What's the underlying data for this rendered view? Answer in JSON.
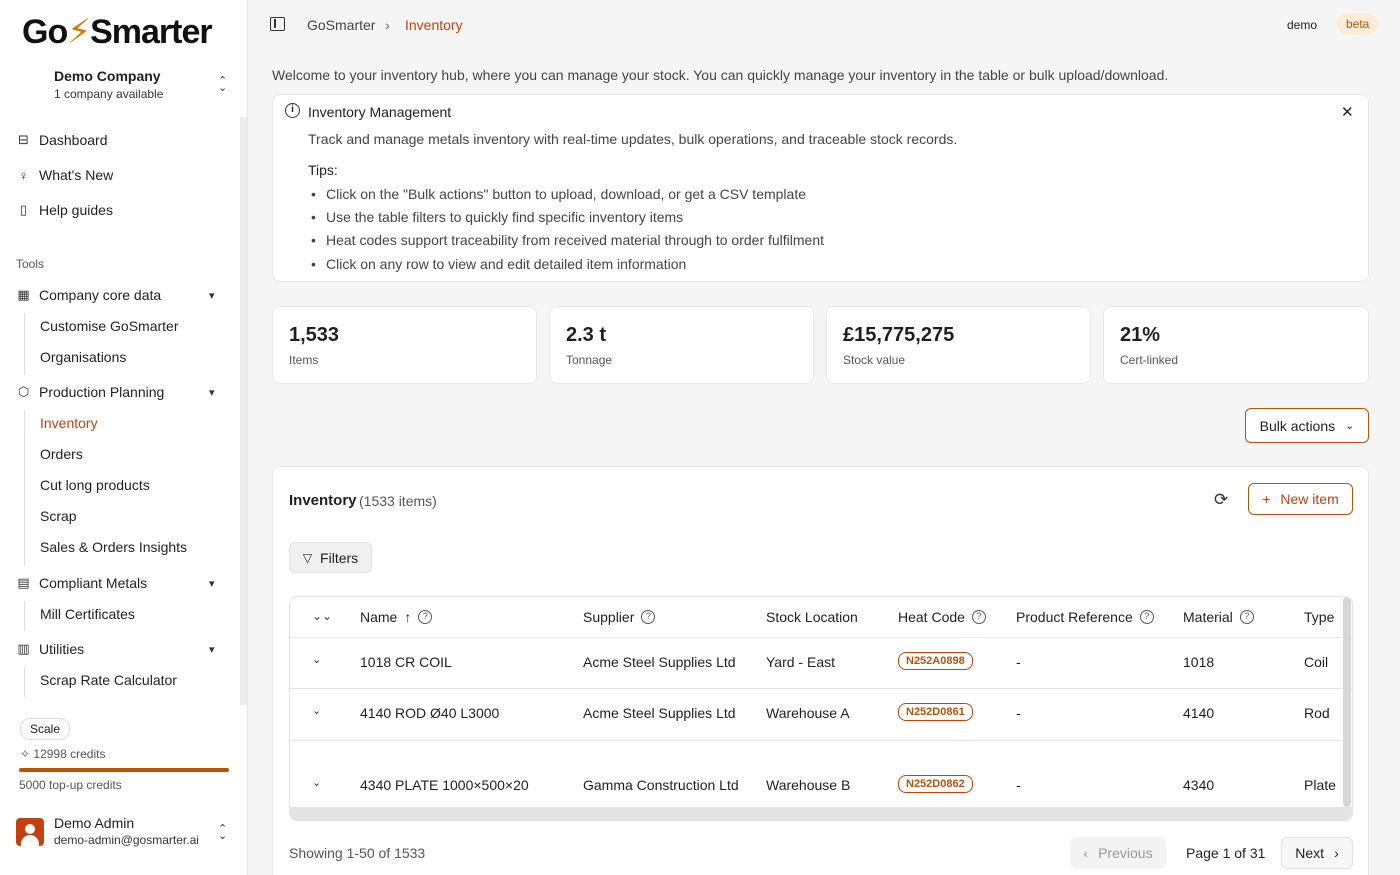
{
  "app": {
    "logo": "GoSmarter"
  },
  "company": {
    "name": "Demo Company",
    "sub": "1 company available"
  },
  "nav": {
    "dashboard": "Dashboard",
    "whats_new": "What's New",
    "help": "Help guides"
  },
  "tools_label": "Tools",
  "groups": {
    "core": {
      "label": "Company core data",
      "items": [
        "Customise GoSmarter",
        "Organisations"
      ]
    },
    "planning": {
      "label": "Production Planning",
      "items": [
        "Inventory",
        "Orders",
        "Cut long products",
        "Scrap",
        "Sales & Orders Insights"
      ]
    },
    "compliant": {
      "label": "Compliant Metals",
      "items": [
        "Mill Certificates"
      ]
    },
    "utilities": {
      "label": "Utilities",
      "items": [
        "Scrap Rate Calculator"
      ]
    }
  },
  "plan": {
    "name": "Scale",
    "credits": "12998 credits",
    "topup": "5000 top-up credits"
  },
  "user": {
    "name": "Demo Admin",
    "email": "demo-admin@gosmarter.ai"
  },
  "breadcrumb": {
    "home": "GoSmarter",
    "sep": "›",
    "current": "Inventory"
  },
  "header": {
    "user": "demo",
    "badge": "beta"
  },
  "welcome": "Welcome to your inventory hub, where you can manage your stock. You can quickly manage your inventory in the table or bulk upload/download.",
  "info": {
    "title": "Inventory Management",
    "desc": "Track and manage metals inventory with real-time updates, bulk operations, and traceable stock records.",
    "tips_title": "Tips:",
    "tips": [
      "Click on the \"Bulk actions\" button to upload, download, or get a CSV template",
      "Use the table filters to quickly find specific inventory items",
      "Heat codes support traceability from received material through to order fulfilment",
      "Click on any row to view and edit detailed item information"
    ]
  },
  "stats": [
    {
      "value": "1,533",
      "label": "Items"
    },
    {
      "value": "2.3 t",
      "label": "Tonnage"
    },
    {
      "value": "£15,775,275",
      "label": "Stock value"
    },
    {
      "value": "21%",
      "label": "Cert-linked"
    }
  ],
  "bulk_label": "Bulk actions",
  "inventory": {
    "title": "Inventory",
    "count": "(1533 items)",
    "new_item": "New item",
    "filters": "Filters"
  },
  "table": {
    "columns": [
      "Name",
      "Supplier",
      "Stock Location",
      "Heat Code",
      "Product Reference",
      "Material",
      "Type"
    ],
    "rows": [
      [
        "1018 CR COIL",
        "Acme Steel Supplies Ltd",
        "Yard - East",
        "N252A0898",
        "-",
        "1018",
        "Coil"
      ],
      [
        "4140 ROD Ø40 L3000",
        "Acme Steel Supplies Ltd",
        "Warehouse A",
        "N252D0861",
        "-",
        "4140",
        "Rod"
      ],
      [
        "4340 PLATE 1000×500×20",
        "Gamma Construction Ltd",
        "Warehouse B",
        "N252D0862",
        "-",
        "4340",
        "Plate"
      ]
    ]
  },
  "pagination": {
    "showing": "Showing 1-50 of 1533",
    "prev": "Previous",
    "page": "Page 1 of 31",
    "next": "Next"
  }
}
